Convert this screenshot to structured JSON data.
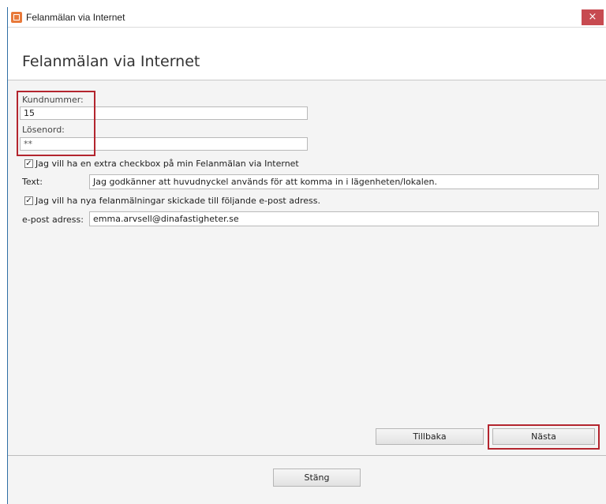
{
  "window": {
    "title": "Felanmälan via Internet",
    "close_glyph": "×",
    "icon": "app-form-icon"
  },
  "header": {
    "title": "Felanmälan via Internet"
  },
  "form": {
    "customer_number_label": "Kundnummer:",
    "customer_number_value": "15",
    "password_label": "Lösenord:",
    "password_value": "**",
    "extra_checkbox": {
      "checked": true,
      "label": "Jag vill ha en extra checkbox på min Felanmälan via Internet"
    },
    "text_label": "Text:",
    "text_value": "Jag godkänner att huvudnyckel används för att komma in i lägenheten/lokalen.",
    "email_checkbox": {
      "checked": true,
      "label": "Jag vill ha nya felanmälningar skickade till följande e-post adress."
    },
    "email_label": "e-post adress:",
    "email_value": "emma.arvsell@dinafastigheter.se"
  },
  "buttons": {
    "back": "Tillbaka",
    "next": "Nästa",
    "close": "Stäng"
  },
  "colors": {
    "highlight": "#b3252e",
    "close_button": "#c74a50",
    "app_icon": "#e8793a"
  }
}
